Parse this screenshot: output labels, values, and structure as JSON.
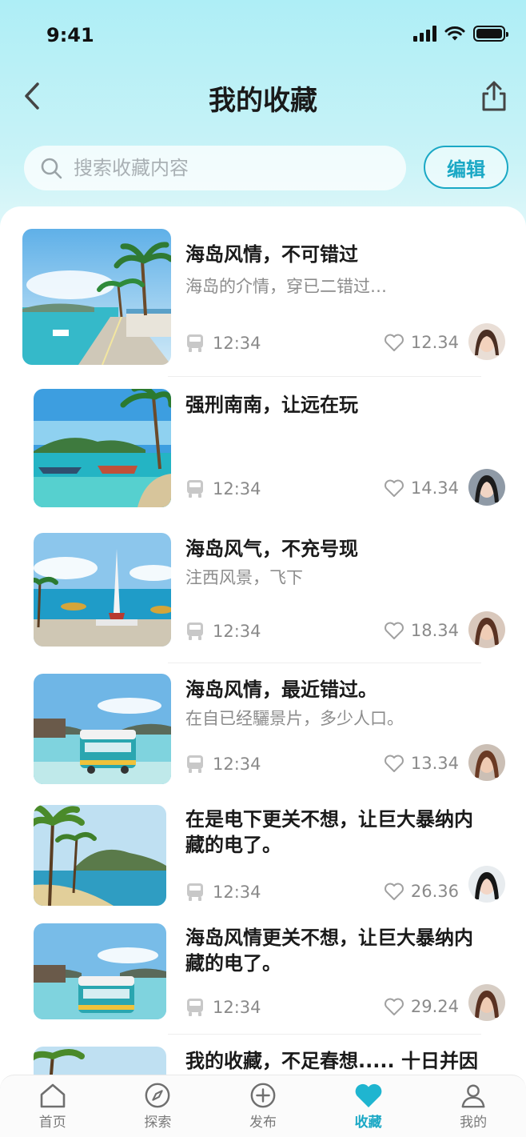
{
  "status_bar": {
    "time": "9:41"
  },
  "header": {
    "title": "我的收藏"
  },
  "search": {
    "placeholder": "搜索收藏内容",
    "edit_label": "编辑"
  },
  "items": [
    {
      "title": "海岛风情，不可错过",
      "desc": "海岛的介情，穿已二错过…",
      "time": "12:34",
      "likes": "12.34"
    },
    {
      "title": "强刑南南，让远在玩",
      "desc": "",
      "time": "12:34",
      "likes": "14.34"
    },
    {
      "title": "海岛风气，不充号现",
      "desc": "注西风景，飞下",
      "time": "12:34",
      "likes": "18.34"
    },
    {
      "title": "海岛风情，最近错过。",
      "desc": "在自已经驪景片，多少人口。",
      "time": "12:34",
      "likes": "13.34"
    },
    {
      "title": "在是电下更关不想，让巨大暴纳内藏的电了。",
      "desc": "",
      "time": "12:34",
      "likes": "26.36"
    },
    {
      "title": "海岛风情更关不想，让巨大暴纳内藏的电了。",
      "desc": "",
      "time": "12:34",
      "likes": "29.24"
    },
    {
      "title": "我的收藏，不足春想..... 十日并因",
      "desc": "",
      "time": "",
      "likes": ""
    }
  ],
  "tabs": [
    {
      "label": "首页",
      "icon": "home-icon"
    },
    {
      "label": "探索",
      "icon": "compass-icon"
    },
    {
      "label": "发布",
      "icon": "plus-circle-icon"
    },
    {
      "label": "收藏",
      "icon": "heart-icon",
      "active": true
    },
    {
      "label": "我的",
      "icon": "user-icon"
    }
  ],
  "colors": {
    "accent": "#1aa8c5",
    "header_gradient_top": "#aeeef6"
  }
}
